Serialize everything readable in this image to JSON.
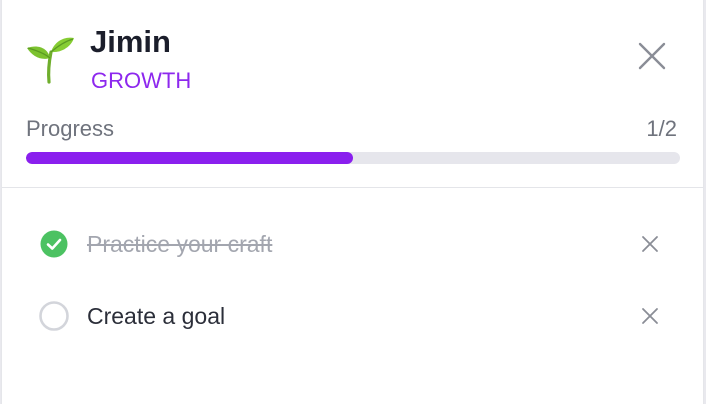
{
  "header": {
    "icon": "seedling-icon",
    "name": "Jimin",
    "category": "GROWTH",
    "close_icon": "close-icon"
  },
  "progress": {
    "label": "Progress",
    "count": "1/2",
    "fraction": 0.5,
    "color": "#8a1fee"
  },
  "tasks": [
    {
      "text": "Practice your craft",
      "completed": true,
      "status_icon": "check-circle-icon",
      "remove_icon": "close-icon"
    },
    {
      "text": "Create a goal",
      "completed": false,
      "status_icon": "empty-circle-icon",
      "remove_icon": "close-icon"
    }
  ],
  "colors": {
    "accent": "#8d28ee",
    "complete": "#4cc262"
  }
}
